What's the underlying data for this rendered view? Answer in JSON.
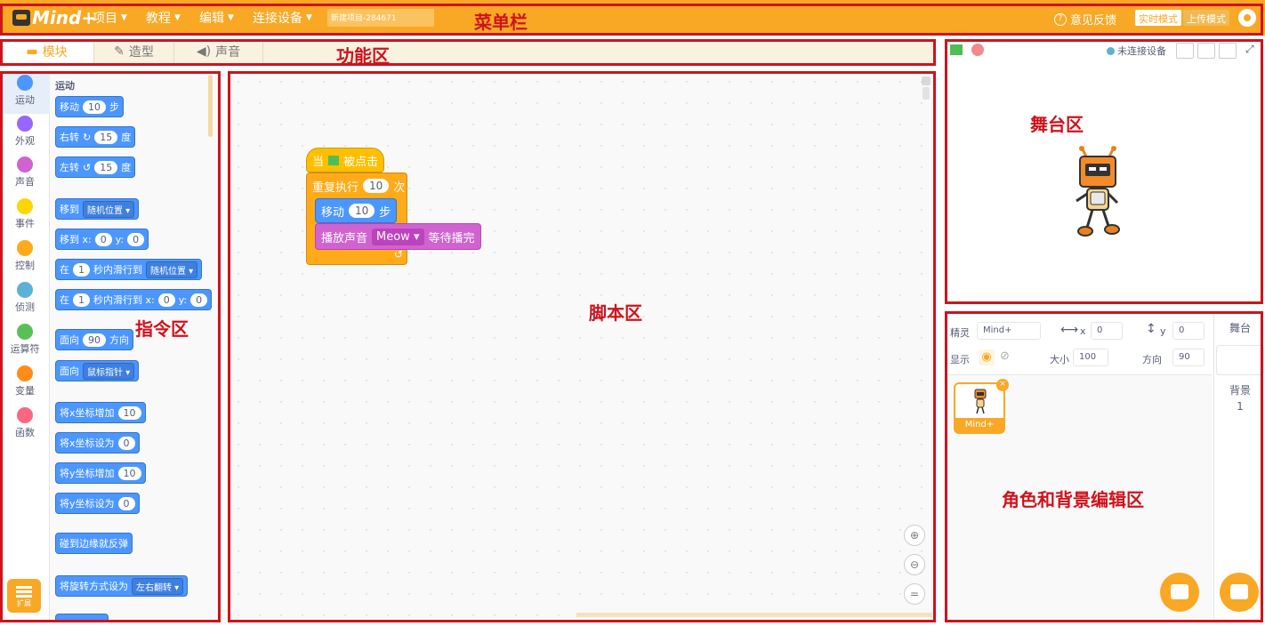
{
  "menubar": {
    "logo_text": "Mind+",
    "menus": [
      "项目",
      "教程",
      "编辑",
      "连接设备"
    ],
    "project_name": "新建项目-284671",
    "feedback": "意见反馈",
    "mode_realtime": "实时模式",
    "mode_upload": "上传模式"
  },
  "tabs": {
    "blocks": "模块",
    "costumes": "造型",
    "sounds": "声音"
  },
  "categories": [
    "运动",
    "外观",
    "声音",
    "事件",
    "控制",
    "侦测",
    "运算符",
    "变量",
    "函数"
  ],
  "category_colors": [
    "#4c97ff",
    "#9966ff",
    "#cf63cf",
    "#ffd500",
    "#ffab19",
    "#5cb1d6",
    "#59c059",
    "#ff8c1a",
    "#ff6680"
  ],
  "extension_label": "扩展",
  "palette": {
    "heading": "运动",
    "blocks": {
      "move": {
        "a": "移动",
        "n": "10",
        "b": "步"
      },
      "turn_right": {
        "a": "右转",
        "icon": "↻",
        "n": "15",
        "b": "度"
      },
      "turn_left": {
        "a": "左转",
        "icon": "↺",
        "n": "15",
        "b": "度"
      },
      "goto": {
        "a": "移到",
        "dd": "随机位置"
      },
      "goto_xy": {
        "a": "移到 x:",
        "x": "0",
        "ylab": "y:",
        "y": "0"
      },
      "glide": {
        "a": "在",
        "n": "1",
        "b": "秒内滑行到",
        "dd": "随机位置"
      },
      "glide_xy": {
        "a": "在",
        "n": "1",
        "b": "秒内滑行到 x:",
        "x": "0",
        "ylab": "y:",
        "y": "0"
      },
      "point_dir": {
        "a": "面向",
        "n": "90",
        "b": "方向"
      },
      "point_towards": {
        "a": "面向",
        "dd": "鼠标指针"
      },
      "change_x": {
        "a": "将x坐标增加",
        "n": "10"
      },
      "set_x": {
        "a": "将x坐标设为",
        "n": "0"
      },
      "change_y": {
        "a": "将y坐标增加",
        "n": "10"
      },
      "set_y": {
        "a": "将y坐标设为",
        "n": "0"
      },
      "bounce": {
        "a": "碰到边缘就反弹"
      },
      "rotation_style": {
        "a": "将旋转方式设为",
        "dd": "左右翻转"
      }
    }
  },
  "script": {
    "hat": {
      "a": "当",
      "b": "被点击"
    },
    "repeat": {
      "a": "重复执行",
      "n": "10",
      "b": "次"
    },
    "move": {
      "a": "移动",
      "n": "10",
      "b": "步"
    },
    "sound": {
      "a": "播放声音",
      "dd": "Meow",
      "b": "等待播完"
    },
    "loop_arrow": "↺"
  },
  "stage": {
    "device_status": "未连接设备"
  },
  "sprite_info": {
    "sprite_label": "精灵",
    "sprite_name": "Mind+",
    "x_label": "x",
    "x_value": "0",
    "y_label": "y",
    "y_value": "0",
    "show_label": "显示",
    "size_label": "大小",
    "size_value": "100",
    "direction_label": "方向",
    "direction_value": "90",
    "thumb_label": "Mind+"
  },
  "stage_panel": {
    "title": "舞台",
    "backdrop_label": "背景",
    "backdrop_count": "1"
  },
  "annotations": {
    "menubar": "菜单栏",
    "function": "功能区",
    "blocks": "指令区",
    "script": "脚本区",
    "stage": "舞台区",
    "sprite": "角色和背景编辑区"
  }
}
